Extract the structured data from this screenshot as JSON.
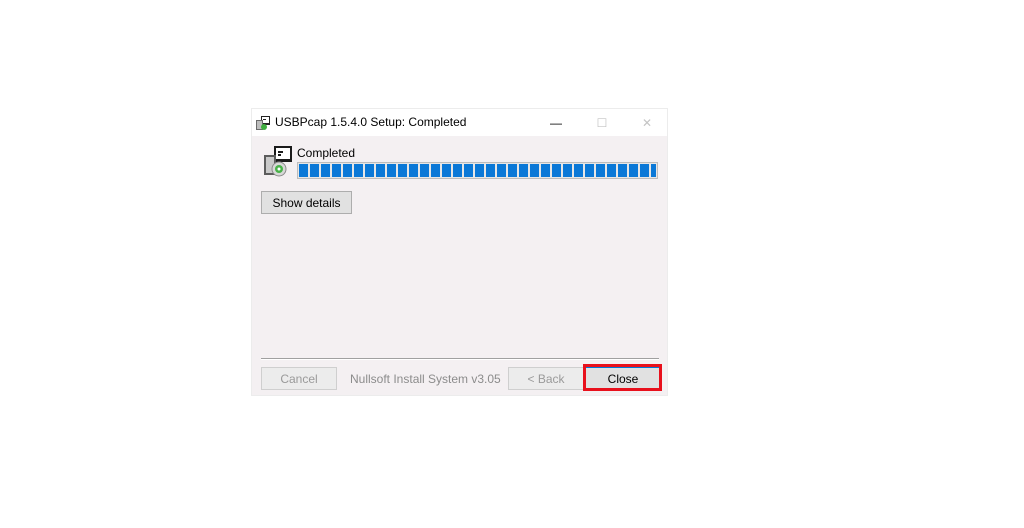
{
  "window": {
    "title": "USBPcap 1.5.4.0 Setup: Completed",
    "app_icon": "installer-icon",
    "controls": {
      "minimize": "—",
      "maximize": "☐",
      "close": "✕"
    }
  },
  "status": {
    "text": "Completed",
    "progress": 1.0
  },
  "buttons": {
    "show_details": "Show details",
    "cancel": "Cancel",
    "back": "< Back",
    "close": "Close"
  },
  "branding": {
    "label": "Nullsoft Install System v3.05"
  },
  "colors": {
    "progress": "#0a78d7",
    "highlight": "#e8101c",
    "window_bg": "#f4f0f2"
  }
}
